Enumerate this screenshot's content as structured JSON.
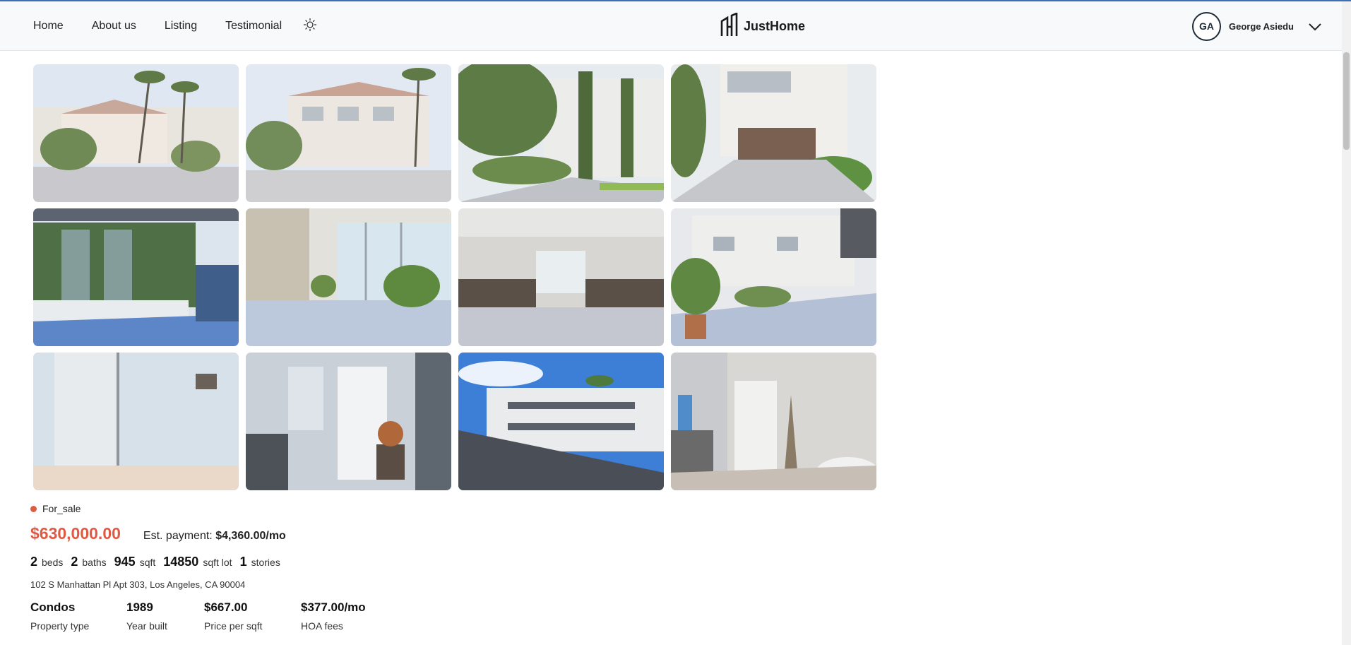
{
  "nav": {
    "items": [
      {
        "label": "Home"
      },
      {
        "label": "About us"
      },
      {
        "label": "Listing"
      },
      {
        "label": "Testimonial"
      }
    ],
    "theme_icon": "sun-icon"
  },
  "brand": {
    "name": "JustHome",
    "logo_icon": "building-logo-icon"
  },
  "user": {
    "initials": "GA",
    "name": "George Asiedu",
    "menu_icon": "chevron-down-icon"
  },
  "gallery": {
    "photos": [
      {
        "alt": "Building exterior with palm trees"
      },
      {
        "alt": "Building front from street"
      },
      {
        "alt": "Walkway with trees"
      },
      {
        "alt": "Garage entrance"
      },
      {
        "alt": "Balcony"
      },
      {
        "alt": "Lobby with plants"
      },
      {
        "alt": "Lobby seating"
      },
      {
        "alt": "Courtyard with planters"
      },
      {
        "alt": "Elevator hallway"
      },
      {
        "alt": "Apartment entry door"
      },
      {
        "alt": "Courtyard view from balcony"
      },
      {
        "alt": "Living room entry"
      }
    ]
  },
  "listing": {
    "status": "For_sale",
    "status_color": "#e05a43",
    "price": "$630,000.00",
    "est_label": "Est. payment:",
    "est_value": "$4,360.00/mo",
    "facts": [
      {
        "value": "2",
        "unit": "beds"
      },
      {
        "value": "2",
        "unit": "baths"
      },
      {
        "value": "945",
        "unit": "sqft"
      },
      {
        "value": "14850",
        "unit": "sqft lot"
      },
      {
        "value": "1",
        "unit": "stories"
      }
    ],
    "address": "102 S Manhattan Pl Apt 303, Los Angeles, CA 90004",
    "stats": [
      {
        "value": "Condos",
        "label": "Property type"
      },
      {
        "value": "1989",
        "label": "Year built"
      },
      {
        "value": "$667.00",
        "label": "Price per sqft"
      },
      {
        "value": "$377.00/mo",
        "label": "HOA fees"
      }
    ]
  },
  "colors": {
    "accent": "#e05a43",
    "header_bg": "#f8f9fb"
  }
}
